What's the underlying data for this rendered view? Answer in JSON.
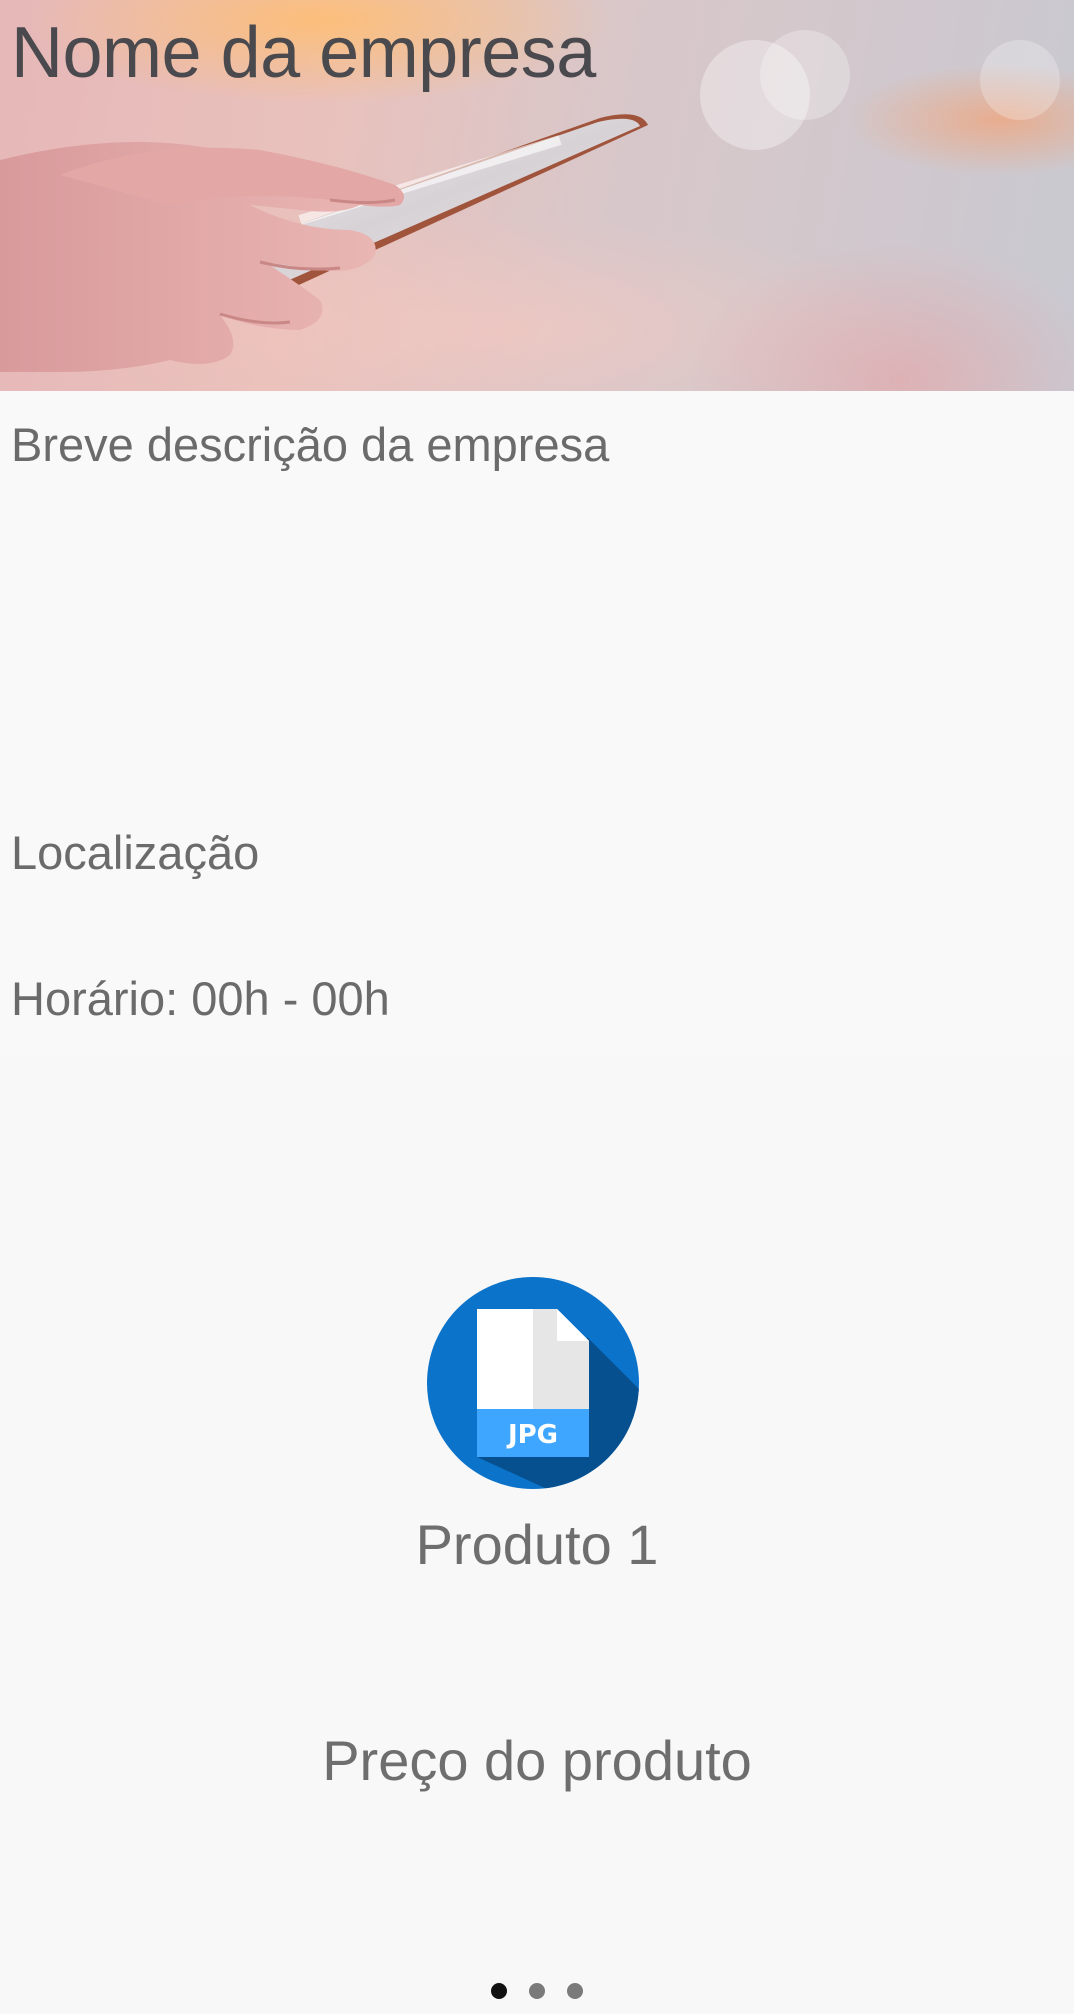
{
  "company": {
    "name": "Nome da empresa",
    "description": "Breve descrição da empresa",
    "location": "Localização",
    "hours": "Horário: 00h - 00h"
  },
  "hero": {
    "image_icon": "hand-holding-phone-photo"
  },
  "product": {
    "icon": "jpg-file-icon",
    "icon_badge": "JPG",
    "name": "Produto 1",
    "price": "Preço do produto"
  },
  "pager": {
    "count": 3,
    "active_index": 0
  },
  "colors": {
    "icon_circle": "#0b73c9",
    "icon_shadow": "#06508f",
    "icon_badge": "#3ea6ff",
    "text": "#6e6e6e",
    "title": "#4a4a4e",
    "dot_active": "#111111",
    "dot_inactive": "#7a7a7a"
  }
}
